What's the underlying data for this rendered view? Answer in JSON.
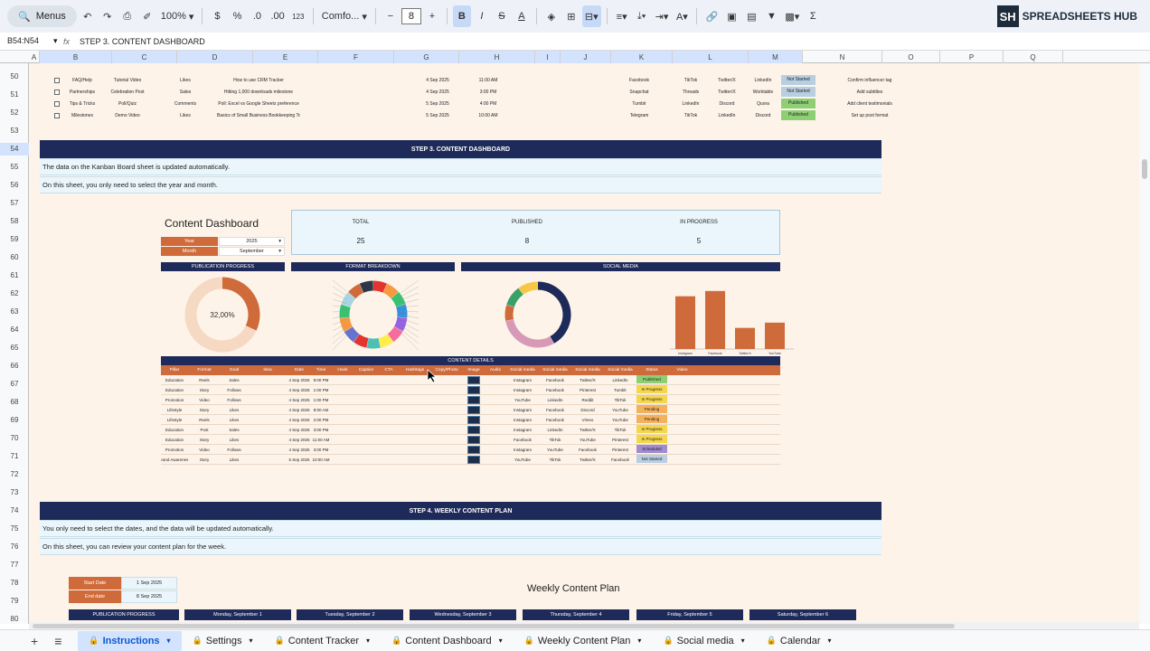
{
  "toolbar": {
    "menus_label": "Menus",
    "zoom": "100%",
    "currency": "$",
    "percent": "%",
    "decimal_decrease": ".0",
    "decimal_increase": ".00",
    "number_format": "123",
    "font_name": "Comfo...",
    "font_size": "8",
    "bold": "B",
    "italic": "I",
    "strike": "S",
    "text_color": "A",
    "sigma": "Σ"
  },
  "brand": {
    "logo": "SH",
    "name": "SPREADSHEETS HUB"
  },
  "formula_bar": {
    "name_box": "B54:N54",
    "fx": "fx",
    "content": "STEP 3. CONTENT DASHBOARD"
  },
  "columns": [
    "A",
    "B",
    "C",
    "D",
    "E",
    "F",
    "G",
    "H",
    "I",
    "J",
    "K",
    "L",
    "M",
    "N",
    "O",
    "P",
    "Q"
  ],
  "rows": [
    "50",
    "51",
    "52",
    "53",
    "54",
    "55",
    "56",
    "57",
    "58",
    "59",
    "60",
    "61",
    "62",
    "63",
    "64",
    "65",
    "66",
    "67",
    "68",
    "69",
    "70",
    "71",
    "72",
    "73",
    "74",
    "75",
    "76",
    "77",
    "78",
    "79",
    "80"
  ],
  "upper_table": [
    {
      "format": "FAQ/Help",
      "type": "Tutorial Video",
      "goal": "Likes",
      "idea": "How to use CRM Tracker",
      "date": "4 Sep 2025",
      "time": "11:00 AM",
      "p1": "Facebook",
      "p2": "TikTok",
      "p3": "Twitter/X",
      "p4": "LinkedIn",
      "status": "Not Started",
      "extra": "Confirm influencer tag"
    },
    {
      "format": "Partnerships",
      "type": "Celebration Post",
      "goal": "Sales",
      "idea": "Hitting 1,000 downloads milestone",
      "date": "4 Sep 2025",
      "time": "3:00 PM",
      "p1": "Snapchat",
      "p2": "Threads",
      "p3": "Twitter/X",
      "p4": "Worktable",
      "status": "Not Started",
      "extra": "Add subtitles"
    },
    {
      "format": "Tips & Tricks",
      "type": "Poll/Quiz",
      "goal": "Comments",
      "idea": "Poll: Excel vs Google Sheets preference",
      "date": "5 Sep 2025",
      "time": "4:00 PM",
      "p1": "Tumblr",
      "p2": "LinkedIn",
      "p3": "Discord",
      "p4": "Quora",
      "status": "Published",
      "extra": "Add client testimonials"
    },
    {
      "format": "Milestones",
      "type": "Demo Video",
      "goal": "Likes",
      "idea": "Basics of Small Business Bookkeeping Tool",
      "date": "5 Sep 2025",
      "time": "10:00 AM",
      "p1": "Telegram",
      "p2": "TikTok",
      "p3": "LinkedIn",
      "p4": "Discord",
      "status": "Published",
      "extra": "Set up post format"
    }
  ],
  "sections": {
    "step3": "STEP 3. CONTENT DASHBOARD",
    "step3_note1": "The data on the Kanban Board sheet is updated automatically.",
    "step3_note2": "On this sheet, you only need to select the year and month.",
    "step4": "STEP 4. WEEKLY CONTENT PLAN",
    "step4_note1": "You only need to select the dates, and the data will be updated automatically.",
    "step4_note2": "On this sheet, you can review your content plan for the week."
  },
  "dashboard": {
    "title": "Content Dashboard",
    "year_label": "Year",
    "year_value": "2025",
    "month_label": "Month",
    "month_value": "September",
    "kpis": [
      {
        "label": "TOTAL",
        "value": "25"
      },
      {
        "label": "PUBLISHED",
        "value": "8"
      },
      {
        "label": "IN PROGRESS",
        "value": "5"
      }
    ],
    "chart_headers": [
      "PUBLICATION PROGRESS",
      "FORMAT BREAKDOWN",
      "SOCIAL MEDIA"
    ],
    "progress_value": "32,00%",
    "content_details_title": "CONTENT DETAILS",
    "details_columns": [
      "Pillar",
      "Format",
      "Goal",
      "Idea",
      "Date",
      "Time",
      "Hook",
      "Caption",
      "CTA",
      "Hashtags",
      "Copy/Photo",
      "Image",
      "Audio",
      "Social media",
      "Social media",
      "Social media",
      "Social media",
      "Status",
      "Video"
    ],
    "details_rows": [
      {
        "pillar": "Education",
        "format": "Reels",
        "goal": "Sales",
        "date": "4 Sep 2025",
        "time": "9:00 PM",
        "s1": "Instagram",
        "s2": "Facebook",
        "s3": "Twitter/X",
        "s4": "LinkedIn",
        "status": "Published"
      },
      {
        "pillar": "Education",
        "format": "Story",
        "goal": "Follows",
        "date": "4 Sep 2025",
        "time": "1:00 PM",
        "s1": "Instagram",
        "s2": "Facebook",
        "s3": "Pinterest",
        "s4": "Tumblr",
        "status": "In Progress"
      },
      {
        "pillar": "Promotion",
        "format": "Video",
        "goal": "Follows",
        "date": "4 Sep 2025",
        "time": "1:00 PM",
        "s1": "YouTube",
        "s2": "LinkedIn",
        "s3": "Reddit",
        "s4": "TikTok",
        "status": "In Progress"
      },
      {
        "pillar": "Lifestyle",
        "format": "Story",
        "goal": "Likes",
        "date": "4 Sep 2025",
        "time": "8:00 AM",
        "s1": "Instagram",
        "s2": "Facebook",
        "s3": "Discord",
        "s4": "YouTube",
        "status": "Pending"
      },
      {
        "pillar": "Lifestyle",
        "format": "Reels",
        "goal": "Likes",
        "date": "4 Sep 2025",
        "time": "2:00 PM",
        "s1": "Instagram",
        "s2": "Facebook",
        "s3": "Vimeo",
        "s4": "YouTube",
        "status": "Pending"
      },
      {
        "pillar": "Education",
        "format": "Post",
        "goal": "Sales",
        "date": "4 Sep 2025",
        "time": "3:00 PM",
        "s1": "Instagram",
        "s2": "LinkedIn",
        "s3": "Twitter/X",
        "s4": "TikTok",
        "status": "In Progress"
      },
      {
        "pillar": "Education",
        "format": "Story",
        "goal": "Likes",
        "date": "4 Sep 2025",
        "time": "11:00 AM",
        "s1": "Facebook",
        "s2": "TikTok",
        "s3": "YouTube",
        "s4": "Pinterest",
        "status": "In Progress"
      },
      {
        "pillar": "Promotion",
        "format": "Video",
        "goal": "Follows",
        "date": "4 Sep 2025",
        "time": "3:00 PM",
        "s1": "Instagram",
        "s2": "YouTube",
        "s3": "Facebook",
        "s4": "Pinterest",
        "status": "Scheduled"
      },
      {
        "pillar": "Brand Awareness",
        "format": "Story",
        "goal": "Likes",
        "date": "5 Sep 2025",
        "time": "10:00 AM",
        "s1": "YouTube",
        "s2": "TikTok",
        "s3": "Twitter/X",
        "s4": "Facebook",
        "status": "Not Started"
      }
    ]
  },
  "weekly_plan": {
    "start_label": "Start Date",
    "start_value": "1 Sep 2025",
    "end_label": "End date",
    "end_value": "8 Sep 2025",
    "title": "Weekly Content Plan",
    "headers": [
      "PUBLICATION PROGRESS",
      "Monday, September 1",
      "Tuesday, September 2",
      "Wednesday, September 3",
      "Thursday, September 4",
      "Friday, September 5",
      "Saturday, September 6"
    ]
  },
  "tabs": [
    {
      "label": "Instructions",
      "active": true
    },
    {
      "label": "Settings",
      "active": false
    },
    {
      "label": "Content Tracker",
      "active": false
    },
    {
      "label": "Content Dashboard",
      "active": false
    },
    {
      "label": "Weekly Content Plan",
      "active": false
    },
    {
      "label": "Social media",
      "active": false
    },
    {
      "label": "Calendar",
      "active": false
    }
  ],
  "chart_data": [
    {
      "type": "pie",
      "categories": [
        "Published",
        "Remaining"
      ],
      "values": [
        32,
        68
      ],
      "colors": [
        "#cf6a3b",
        "#f6d9c3"
      ]
    },
    {
      "type": "bar",
      "categories": [
        "Instagram",
        "Facebook",
        "Twitter/X",
        "YouTube"
      ],
      "values": [
        5,
        5.5,
        2,
        2.5
      ],
      "ylim": [
        0,
        6
      ]
    }
  ],
  "colors": {
    "navy": "#1e2a5a",
    "orange": "#cf6a3b",
    "cream": "#fdf3e9",
    "published": "#8fcf74",
    "in_progress": "#f5d74d",
    "pending": "#f4b15c",
    "scheduled": "#a08ccf",
    "not_started": "#b8cfe2"
  }
}
